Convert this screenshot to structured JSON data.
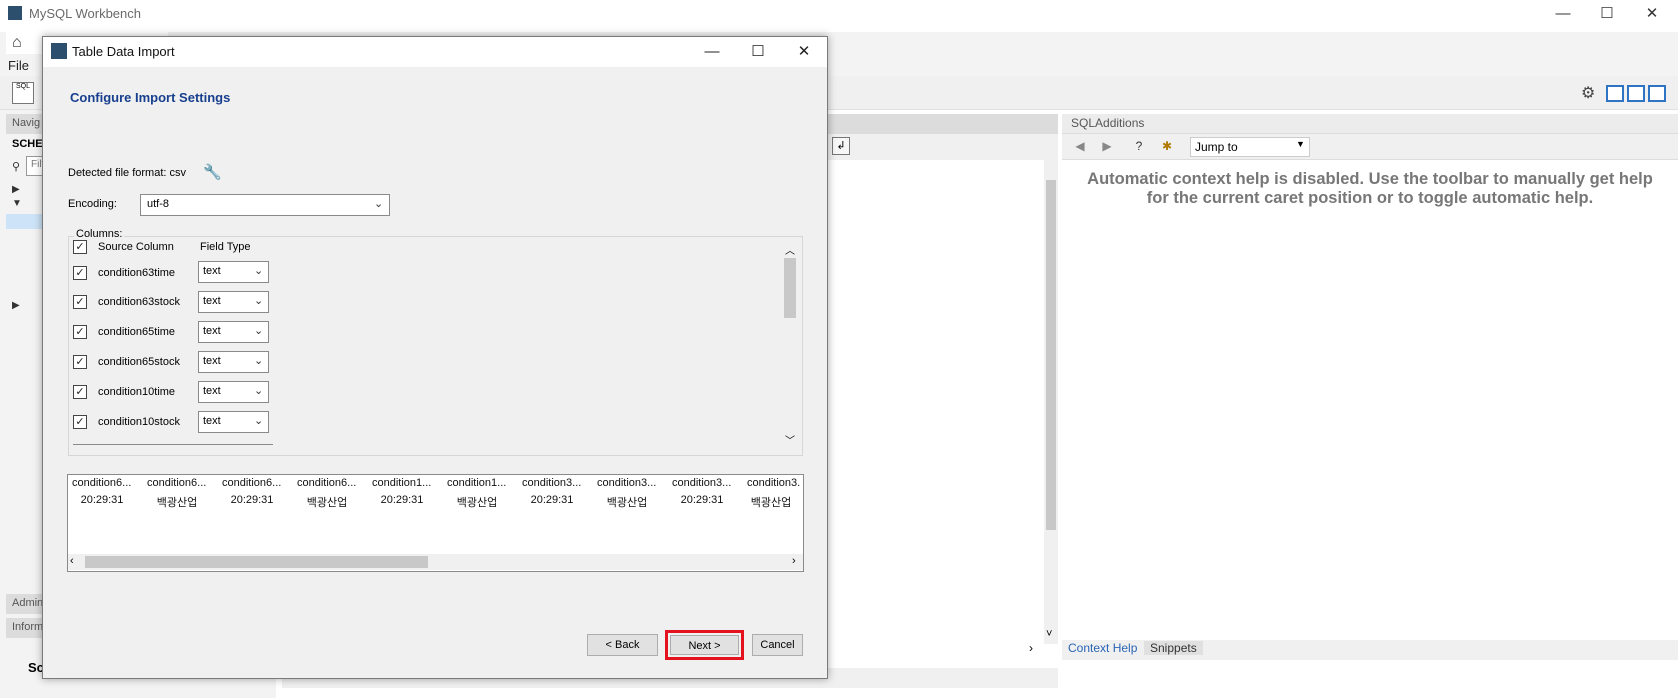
{
  "app": {
    "title": "MySQL Workbench",
    "menu_file": "File"
  },
  "left_panel": {
    "navigator_header": "Navig",
    "schemas_label": "SCHEM",
    "filter_placeholder": "Filt",
    "admin_tab": "Admin",
    "info_tab": "Inform",
    "bottom_text": "Sc"
  },
  "sql_additions": {
    "title": "SQLAdditions",
    "jump_to": "Jump to",
    "context_help_text": "Automatic context help is disabled. Use the toolbar to manually get help for the current caret position or to toggle automatic help.",
    "tab_context_help": "Context Help",
    "tab_snippets": "Snippets"
  },
  "dialog": {
    "title": "Table Data Import",
    "heading": "Configure Import Settings",
    "detected_format": "Detected file format: csv",
    "encoding_label": "Encoding:",
    "encoding_value": "utf-8",
    "columns_label": "Columns:",
    "header_source": "Source Column",
    "header_field_type": "Field Type",
    "columns": [
      {
        "name": "condition63time",
        "type": "text",
        "checked": true
      },
      {
        "name": "condition63stock",
        "type": "text",
        "checked": true
      },
      {
        "name": "condition65time",
        "type": "text",
        "checked": true
      },
      {
        "name": "condition65stock",
        "type": "text",
        "checked": true
      },
      {
        "name": "condition10time",
        "type": "text",
        "checked": true
      },
      {
        "name": "condition10stock",
        "type": "text",
        "checked": true
      }
    ],
    "preview_headers": [
      "condition6...",
      "condition6...",
      "condition6...",
      "condition6...",
      "condition1...",
      "condition1...",
      "condition3...",
      "condition3...",
      "condition3...",
      "condition3."
    ],
    "preview_row": [
      "20:29:31",
      "백광산업",
      "20:29:31",
      "백광산업",
      "20:29:31",
      "백광산업",
      "20:29:31",
      "백광산업",
      "20:29:31",
      "백광산업"
    ],
    "back_button": "< Back",
    "next_button": "Next >",
    "cancel_button": "Cancel"
  }
}
